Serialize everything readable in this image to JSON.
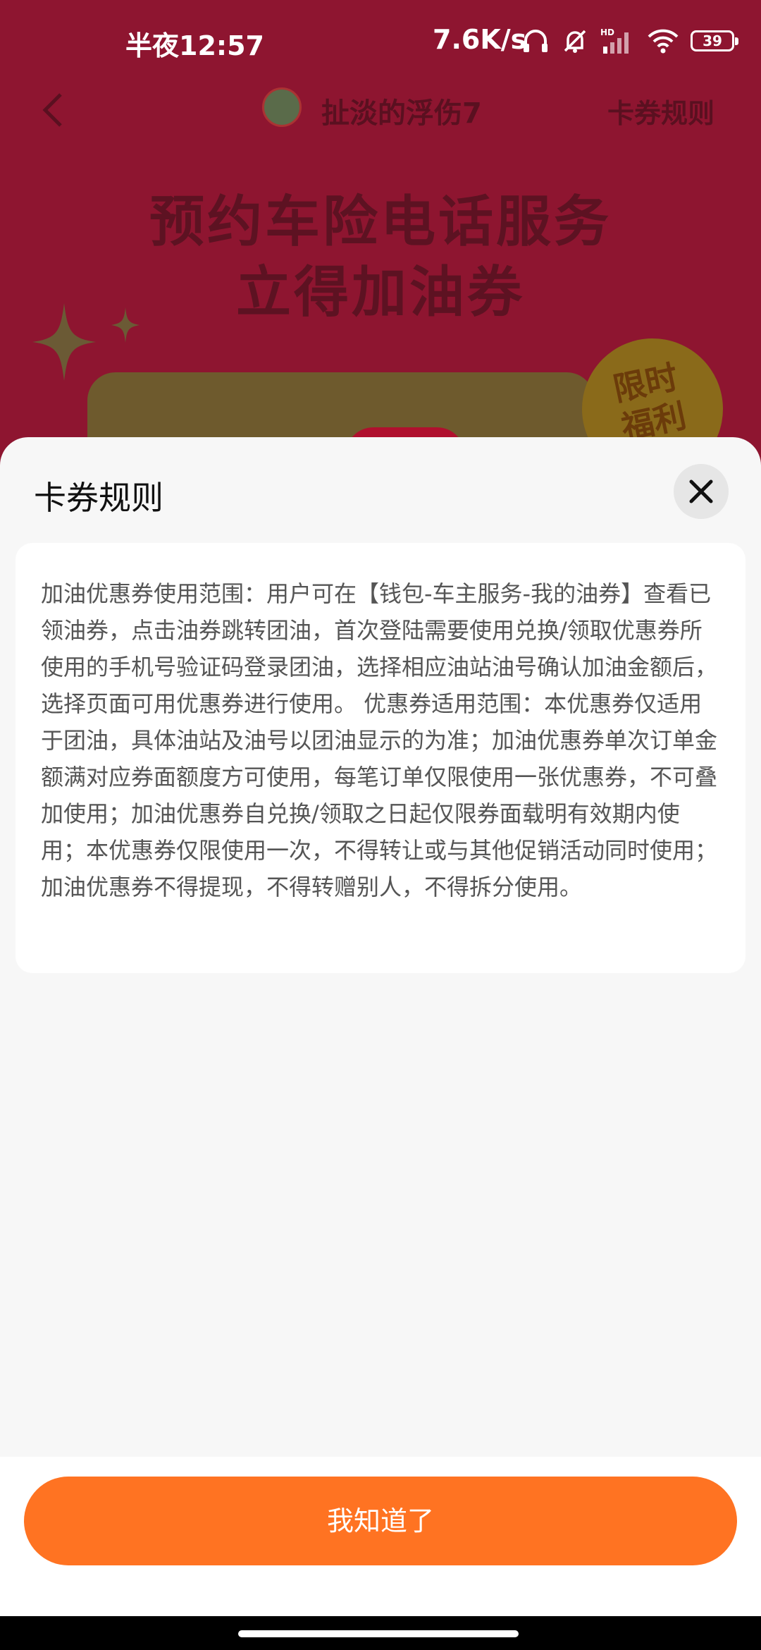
{
  "status_bar": {
    "time": "半夜12:57",
    "network_speed": "7.6K/s",
    "signal_label": "HD",
    "battery_level": "39",
    "icons": [
      "headset-icon",
      "mute-bell-icon",
      "signal-icon",
      "wifi-icon",
      "battery-icon"
    ]
  },
  "background_page": {
    "nav": {
      "back_icon": "chevron-left-icon",
      "title": "扯淡的浮伤7",
      "rules_link": "卡券规则"
    },
    "hero": {
      "line1": "预约车险电话服务",
      "line2": "立得加油券",
      "badge_line1": "限时",
      "badge_line2": "福利"
    },
    "colors": {
      "background": "#8e1530"
    }
  },
  "sheet": {
    "title": "卡券规则",
    "close_icon": "close-icon",
    "rules_text": "加油优惠券使用范围：用户可在【钱包-车主服务-我的油券】查看已领油券，点击油券跳转团油，首次登陆需要使用兑换/领取优惠券所使用的手机号验证码登录团油，选择相应油站油号确认加油金额后，选择页面可用优惠券进行使用。 优惠券适用范围：本优惠券仅适用于团油，具体油站及油号以团油显示的为准；加油优惠券单次订单金额满对应券面额度方可使用，每笔订单仅限使用一张优惠券，不可叠加使用；加油优惠券自兑换/领取之日起仅限券面载明有效期内使用；本优惠券仅限使用一次，不得转让或与其他促销活动同时使用；加油优惠券不得提现，不得转赠别人，不得拆分使用。",
    "confirm_button": "我知道了",
    "colors": {
      "accent": "#ff7322",
      "sheet_background": "#f7f7f7"
    }
  }
}
